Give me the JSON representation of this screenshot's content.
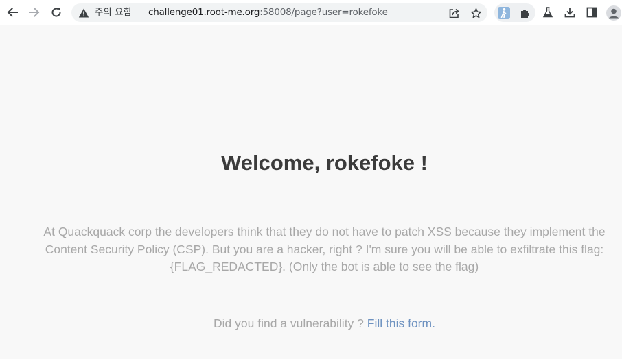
{
  "browser": {
    "security_status": "주의 요함",
    "url": {
      "host": "challenge01.root-me.org",
      "rest": ":58008/page?user=rokefoke"
    },
    "icons": {
      "back": "arrow-left-icon",
      "forward": "arrow-right-icon",
      "reload": "reload-icon",
      "warning": "warning-triangle-icon",
      "share": "share-icon",
      "bookmark": "star-icon",
      "extension_1": "walking-person-extension-icon",
      "extensions": "puzzle-piece-icon",
      "labs": "flask-icon",
      "downloads": "download-icon",
      "side_panel": "side-panel-icon",
      "profile": "profile-avatar-icon"
    }
  },
  "page": {
    "headline": "Welcome, rokefoke !",
    "description": "At Quackquack corp the developers think that they do not have to patch XSS because they implement the Content Security Policy (CSP). But you are a hacker, right ? I'm sure you will be able to exfiltrate this flag: {FLAG_REDACTED}. (Only the bot is able to see the flag)",
    "report_prefix": "Did you find a vulnerability ?",
    "report_link": "Fill this form."
  },
  "colors": {
    "background": "#f8f8f8",
    "headline": "#3b3b3b",
    "body_text": "#a8a8a8",
    "link": "#6e92c0"
  }
}
